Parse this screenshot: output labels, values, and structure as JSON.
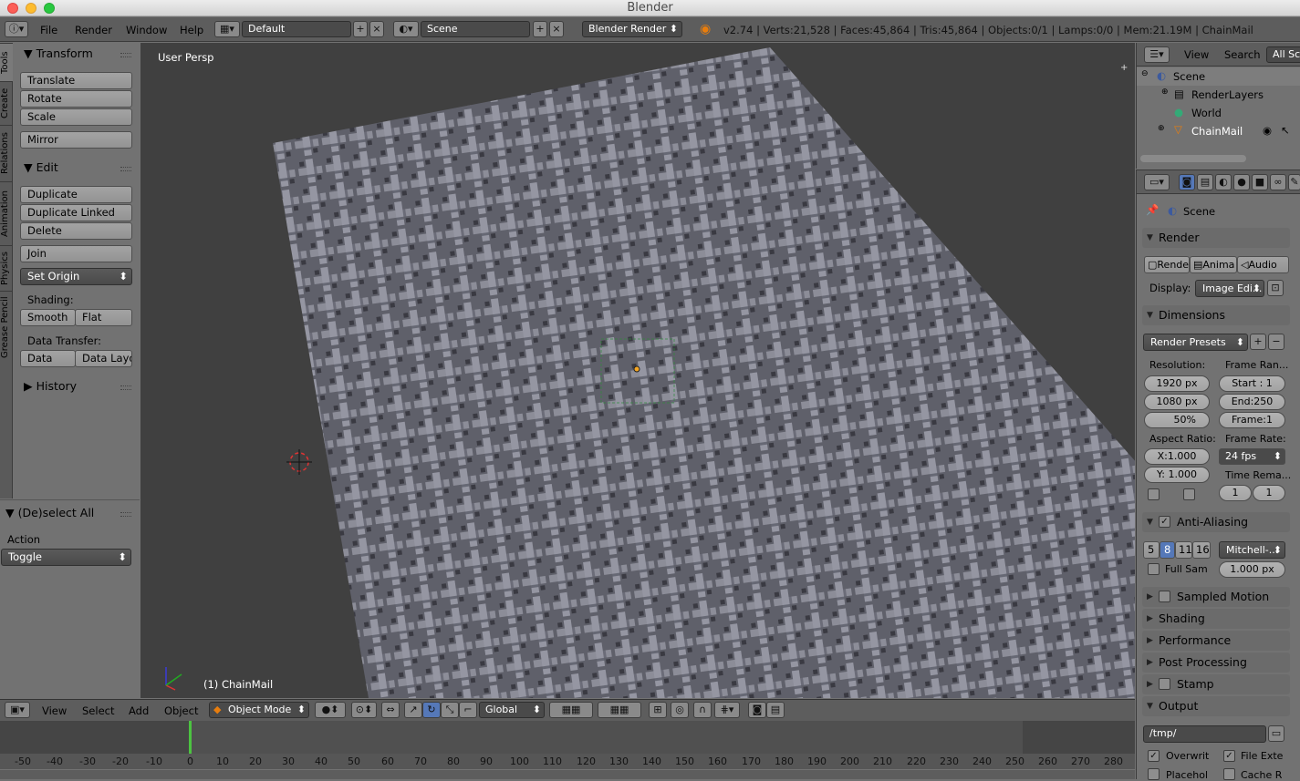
{
  "window": {
    "title": "Blender"
  },
  "menubar": {
    "items": [
      "File",
      "Render",
      "Window",
      "Help"
    ],
    "layout": "Default",
    "scene": "Scene",
    "engine": "Blender Render",
    "stats": "v2.74 | Verts:21,528 | Faces:45,864 | Tris:45,864 | Objects:0/1 | Lamps:0/0 | Mem:21.19M | ChainMail"
  },
  "vtabs": [
    "Tools",
    "Create",
    "Relations",
    "Animation",
    "Physics",
    "Grease Pencil"
  ],
  "toolshelf": {
    "transform": {
      "title": "Transform",
      "buttons": [
        "Translate",
        "Rotate",
        "Scale",
        "Mirror"
      ]
    },
    "edit": {
      "title": "Edit",
      "buttons": [
        "Duplicate",
        "Duplicate Linked",
        "Delete",
        "Join"
      ],
      "set_origin": "Set Origin"
    },
    "shading": {
      "label": "Shading:",
      "smooth": "Smooth",
      "flat": "Flat"
    },
    "data_transfer": {
      "label": "Data Transfer:",
      "data": "Data",
      "data_layout": "Data Layo"
    },
    "history": "History"
  },
  "operator": {
    "title": "(De)select All",
    "action_label": "Action",
    "action_value": "Toggle"
  },
  "viewport": {
    "view_name": "User Persp",
    "object_label": "(1) ChainMail"
  },
  "outliner": {
    "view": "View",
    "search": "Search",
    "filter": "All Sc",
    "tree": [
      "Scene",
      "RenderLayers",
      "World",
      "ChainMail"
    ]
  },
  "properties": {
    "context": "Scene",
    "render": {
      "title": "Render",
      "render_btn": "Rende",
      "anim_btn": "Anima",
      "audio_btn": "Audio",
      "display_label": "Display:",
      "display_value": "Image Edi..."
    },
    "dimensions": {
      "title": "Dimensions",
      "presets": "Render Presets",
      "resolution_label": "Resolution:",
      "res_x": "1920 px",
      "res_y": "1080 px",
      "res_pct": "50%",
      "frame_range_label": "Frame Ran...",
      "start": "Start : 1",
      "end": "End:250",
      "frame": "Frame:1",
      "aspect_label": "Aspect Ratio:",
      "aspect_x": "X:1.000",
      "aspect_y": "Y: 1.000",
      "framerate_label": "Frame Rate:",
      "fps": "24 fps",
      "time_remap_label": "Time Rema...",
      "remap_old": "1",
      "remap_new": "1"
    },
    "aa": {
      "title": "Anti-Aliasing",
      "samples": [
        "5",
        "8",
        "11",
        "16"
      ],
      "filter": "Mitchell-...",
      "full_sample": "Full Sam",
      "size": "1.000 px"
    },
    "sections": [
      "Sampled Motion Blur",
      "Shading",
      "Performance",
      "Post Processing",
      "Stamp"
    ],
    "output": {
      "title": "Output",
      "path": "/tmp/",
      "overwrite": "Overwrit",
      "file_ext": "File Exte",
      "placeholders": "Placehol",
      "cache": "Cache R"
    }
  },
  "header3d": {
    "menus": [
      "View",
      "Select",
      "Add",
      "Object"
    ],
    "mode": "Object Mode",
    "orientation": "Global"
  },
  "timeline": {
    "ticks": [
      "-50",
      "-40",
      "-30",
      "-20",
      "-10",
      "0",
      "10",
      "20",
      "30",
      "40",
      "50",
      "60",
      "70",
      "80",
      "90",
      "100",
      "110",
      "120",
      "130",
      "140",
      "150",
      "160",
      "170",
      "180",
      "190",
      "200",
      "210",
      "220",
      "230",
      "240",
      "250",
      "260",
      "270",
      "280"
    ],
    "current_frame": 1
  }
}
